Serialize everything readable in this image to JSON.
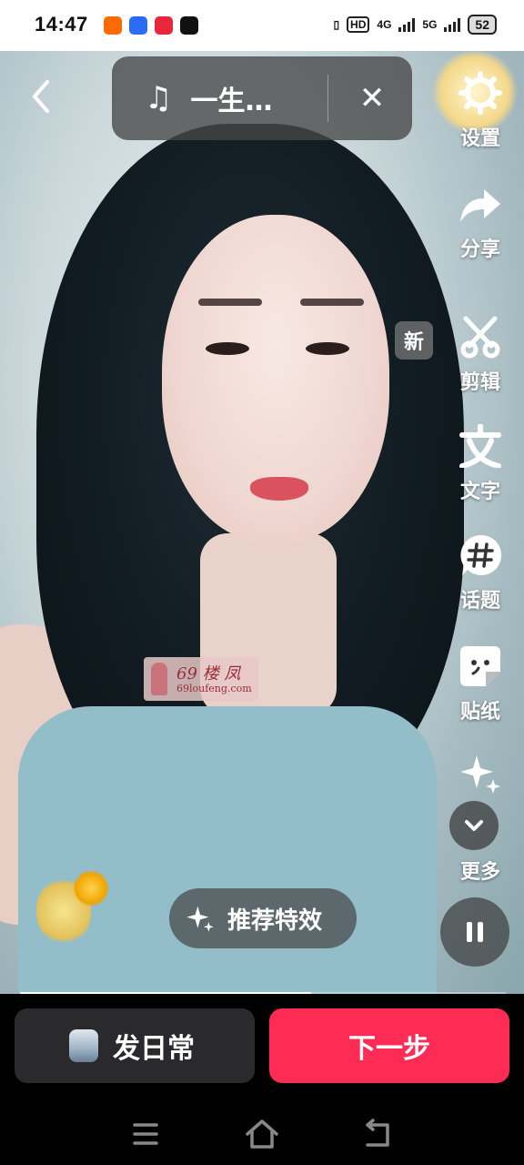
{
  "status_bar": {
    "time": "14:47",
    "battery": "52",
    "hd_label": "HD",
    "net1": "4G",
    "net2": "5G"
  },
  "music": {
    "title": "一生…",
    "icon": "music-note-icon"
  },
  "toolbar": {
    "settings": "设置",
    "share": "分享",
    "edit": "剪辑",
    "edit_badge": "新",
    "text": "文字",
    "topic": "话题",
    "sticker": "贴纸",
    "more": "更多"
  },
  "effects": {
    "label": "推荐特效"
  },
  "watermark": {
    "line1": "69 楼 凤",
    "line2": "69loufeng.com"
  },
  "progress": {
    "fraction": 0.6
  },
  "actions": {
    "daily": "发日常",
    "next": "下一步"
  },
  "colors": {
    "accent": "#fe2c55",
    "secondary_button": "#2a2a2c"
  }
}
